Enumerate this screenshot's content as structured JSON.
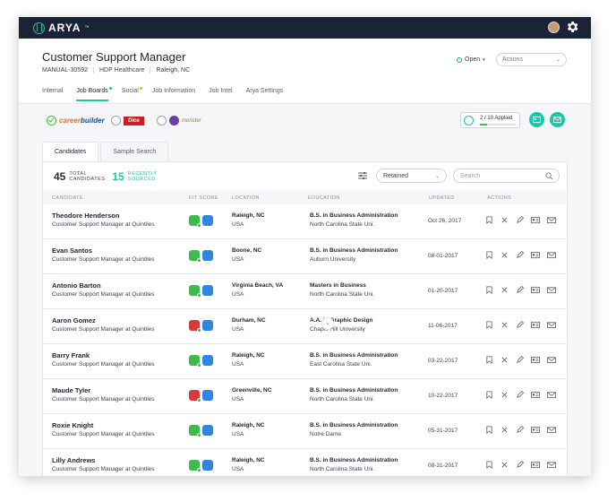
{
  "app": {
    "name": "ARYA",
    "tm": "™"
  },
  "job": {
    "title": "Customer Support Manager",
    "id": "MANUAL-30592",
    "company": "HDP Healthcare",
    "location": "Raleigh, NC",
    "status": "Open",
    "actions_label": "Actions"
  },
  "nav_tabs": [
    {
      "label": "Internal"
    },
    {
      "label": "Job Boards",
      "dot_color": "#14c8a8"
    },
    {
      "label": "Social",
      "dot_color": "#f5a623"
    },
    {
      "label": "Job Information"
    },
    {
      "label": "Job Intel"
    },
    {
      "label": "Arya Settings"
    }
  ],
  "boards": {
    "careerbuilder": {
      "text_a": "career",
      "text_b": "builder"
    },
    "dice": "Dice",
    "monster": "monster"
  },
  "applied": {
    "label": "2 / 10 Applied",
    "fraction": 0.2
  },
  "candidate_tabs": [
    "Candidates",
    "Sample Search"
  ],
  "counts": {
    "total_num": "45",
    "total_label_1": "TOTAL",
    "total_label_2": "CANDIDATES",
    "recent_num": "15",
    "recent_label_1": "RECENTLY",
    "recent_label_2": "SOURCED"
  },
  "filter": {
    "selected": "Retained"
  },
  "search": {
    "placeholder": "Search"
  },
  "columns": [
    "CANDIDATE",
    "FIT SCORE",
    "LOCATION",
    "EDUCATION",
    "UPDATED",
    "ACTIONS"
  ],
  "rows": [
    {
      "name": "Theodore Henderson",
      "role": "Customer Support Manager at Quintiles",
      "fit": "green",
      "city": "Raleigh, NC",
      "country": "USA",
      "degree": "B.S. in Business Administration",
      "school": "North Carolina State Uni.",
      "updated": "Oct 26, 2017"
    },
    {
      "name": "Evan Santos",
      "role": "Customer Support Manager at Quintiles",
      "fit": "green",
      "city": "Boone, NC",
      "country": "USA",
      "degree": "B.S. in Business Administration",
      "school": "Auburn University",
      "updated": "08-01-2017"
    },
    {
      "name": "Antonio Barton",
      "role": "Customer Support Manager at Quintiles",
      "fit": "green",
      "city": "Virginia Beach, VA",
      "country": "USA",
      "degree": "Masters in Business",
      "school": "North Carolina State Uni.",
      "updated": "01-20-2017"
    },
    {
      "name": "Aaron Gomez",
      "role": "Customer Support Manager at Quintiles",
      "fit": "red",
      "city": "Durham, NC",
      "country": "USA",
      "degree": "A.A. in Graphic Design",
      "school": "Chapel Hill University",
      "updated": "11-06-2017"
    },
    {
      "name": "Barry Frank",
      "role": "Customer Support Manager at Quintiles",
      "fit": "green",
      "city": "Raleigh, NC",
      "country": "USA",
      "degree": "B.S. in Business Administration",
      "school": "East Carolina State Uni.",
      "updated": "03-22-2017"
    },
    {
      "name": "Maude Tyler",
      "role": "Customer Support Manager at Quintiles",
      "fit": "red",
      "city": "Greenville, NC",
      "country": "USA",
      "degree": "B.S. in Business Administration",
      "school": "North Carolina State Uni.",
      "updated": "10-22-2017"
    },
    {
      "name": "Roxie Knight",
      "role": "Customer Support Manager at Quintiles",
      "fit": "green",
      "city": "Raleigh, NC",
      "country": "USA",
      "degree": "B.S. in Business Administration",
      "school": "Notre Dame",
      "updated": "05-31-2017"
    },
    {
      "name": "Lilly Andrews",
      "role": "Customer Support Manager at Quintiles",
      "fit": "green",
      "city": "Raleigh, NC",
      "country": "USA",
      "degree": "B.S. in Business Administration",
      "school": "North Carolina State Uni.",
      "updated": "08-31-2017"
    }
  ],
  "icons": {
    "logo": "arya-logo-icon",
    "avatar": "user-avatar",
    "settings": "gear-icon",
    "filter": "filter-sliders-icon",
    "search": "search-icon",
    "row_actions": [
      "bookmark-icon",
      "close-icon",
      "edit-icon",
      "contact-card-icon",
      "mail-icon"
    ],
    "fit": [
      "fit-score-hexagon-icon",
      "profile-hexagon-icon"
    ],
    "expand": "chevron-down-icon"
  },
  "colors": {
    "accent": "#14c8a8",
    "topbar": "#1b2434",
    "fit_green": "#3dbb4c",
    "fit_red": "#d63a3a",
    "fit_blue": "#2f86e0",
    "social_dot": "#f5a623"
  }
}
